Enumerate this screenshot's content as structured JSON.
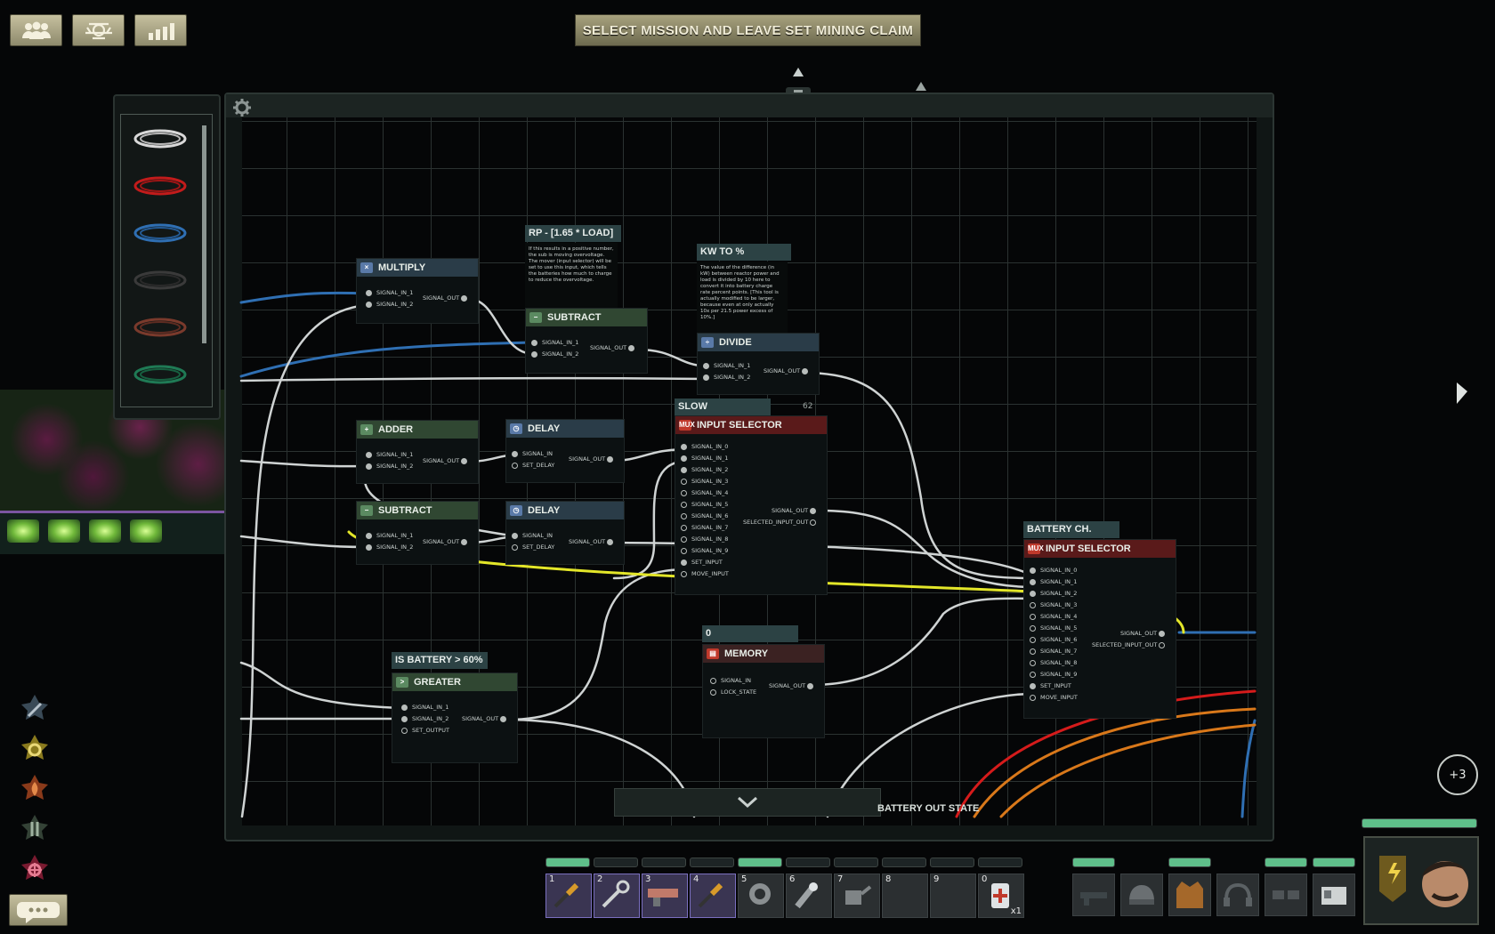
{
  "header": {
    "mission_button": "SELECT MISSION AND LEAVE SET MINING CLAIM",
    "icons": [
      "crew-icon",
      "submarine-icon",
      "stats-icon"
    ]
  },
  "cable_inventory": {
    "colors": [
      "#d8d8d8",
      "#c21b1b",
      "#2f6fb3",
      "#2e2e2e",
      "#7a3a2c",
      "#1f7a55"
    ]
  },
  "nodes": {
    "multiply": {
      "title": "MULTIPLY",
      "in1": "SIGNAL_IN_1",
      "in2": "SIGNAL_IN_2",
      "out": "SIGNAL_OUT"
    },
    "rp_label": {
      "title": "RP - [1.65 * LOAD]",
      "note": "If this results in a positive number, the sub is moving overvoltage. The mover (input selector) will be set to use this input, which tells the batteries how much to charge to reduce the overvoltage."
    },
    "subtract_top": {
      "title": "SUBTRACT",
      "in1": "SIGNAL_IN_1",
      "in2": "SIGNAL_IN_2",
      "out": "SIGNAL_OUT"
    },
    "kw_label": {
      "title": "KW TO % CONVERSION",
      "note": "The value of the difference (in kW) between reactor power and load is divided by 10 here to convert it into battery charge rate percent points. [This tool is actually modified to be larger, because even at only actually 10x per 21.5 power excess of 10%.]"
    },
    "divide": {
      "title": "DIVIDE",
      "in1": "SIGNAL_IN_1",
      "in2": "SIGNAL_IN_2",
      "out": "SIGNAL_OUT"
    },
    "adder": {
      "title": "ADDER",
      "in1": "SIGNAL_IN_1",
      "in2": "SIGNAL_IN_2",
      "out": "SIGNAL_OUT"
    },
    "delay1": {
      "title": "DELAY",
      "in": "SIGNAL_IN",
      "set": "SET_DELAY",
      "out": "SIGNAL_OUT"
    },
    "subtract_mid": {
      "title": "SUBTRACT",
      "in1": "SIGNAL_IN_1",
      "in2": "SIGNAL_IN_2",
      "out": "SIGNAL_OUT"
    },
    "delay2": {
      "title": "DELAY",
      "in": "SIGNAL_IN",
      "set": "SET_DELAY",
      "out": "SIGNAL_OUT"
    },
    "slow_label": {
      "title": "SLOW IN-/DECREASE",
      "counter": "62"
    },
    "input_selector1": {
      "title": "INPUT SELECTOR",
      "ports": [
        "SIGNAL_IN_0",
        "SIGNAL_IN_1",
        "SIGNAL_IN_2",
        "SIGNAL_IN_3",
        "SIGNAL_IN_4",
        "SIGNAL_IN_5",
        "SIGNAL_IN_6",
        "SIGNAL_IN_7",
        "SIGNAL_IN_8",
        "SIGNAL_IN_9",
        "SET_INPUT",
        "MOVE_INPUT"
      ],
      "out": "SIGNAL_OUT",
      "out2": "SELECTED_INPUT_OUT"
    },
    "battery_label": {
      "title": "BATTERY CH. RATE"
    },
    "input_selector2": {
      "title": "INPUT SELECTOR",
      "ports": [
        "SIGNAL_IN_0",
        "SIGNAL_IN_1",
        "SIGNAL_IN_2",
        "SIGNAL_IN_3",
        "SIGNAL_IN_4",
        "SIGNAL_IN_5",
        "SIGNAL_IN_6",
        "SIGNAL_IN_7",
        "SIGNAL_IN_8",
        "SIGNAL_IN_9",
        "SET_INPUT",
        "MOVE_INPUT"
      ],
      "out": "SIGNAL_OUT",
      "out2": "SELECTED_INPUT_OUT"
    },
    "zero_label": {
      "title": "0"
    },
    "memory": {
      "title": "MEMORY",
      "in": "SIGNAL_IN",
      "lock": "LOCK_STATE",
      "out": "SIGNAL_OUT"
    },
    "battery60_label": {
      "title": "IS BATTERY > 60%"
    },
    "greater": {
      "title": "GREATER",
      "in1": "SIGNAL_IN_1",
      "in2": "SIGNAL_IN_2",
      "set": "SET_OUTPUT",
      "out": "SIGNAL_OUT"
    }
  },
  "battery_out_label": "BATTERY OUT STATE",
  "hotbar": [
    {
      "num": "1",
      "item": "screwdriver-icon"
    },
    {
      "num": "2",
      "item": "wrench-icon"
    },
    {
      "num": "3",
      "item": "welding-tool-icon"
    },
    {
      "num": "4",
      "item": "screwdriver-icon"
    },
    {
      "num": "5",
      "item": "diving-mask-icon"
    },
    {
      "num": "6",
      "item": "flashlight-icon"
    },
    {
      "num": "7",
      "item": "watering-can-icon"
    },
    {
      "num": "8",
      "item": ""
    },
    {
      "num": "9",
      "item": ""
    },
    {
      "num": "0",
      "item": "medkit-icon",
      "count": "x1"
    }
  ],
  "notification_count": "+3",
  "colors": {
    "yellow_wire": "#e3e629",
    "blue_wire": "#2f6fb3",
    "red_wire": "#d51b1b",
    "orange_wire": "#d9781a",
    "white_wire": "#cfd3d3"
  }
}
